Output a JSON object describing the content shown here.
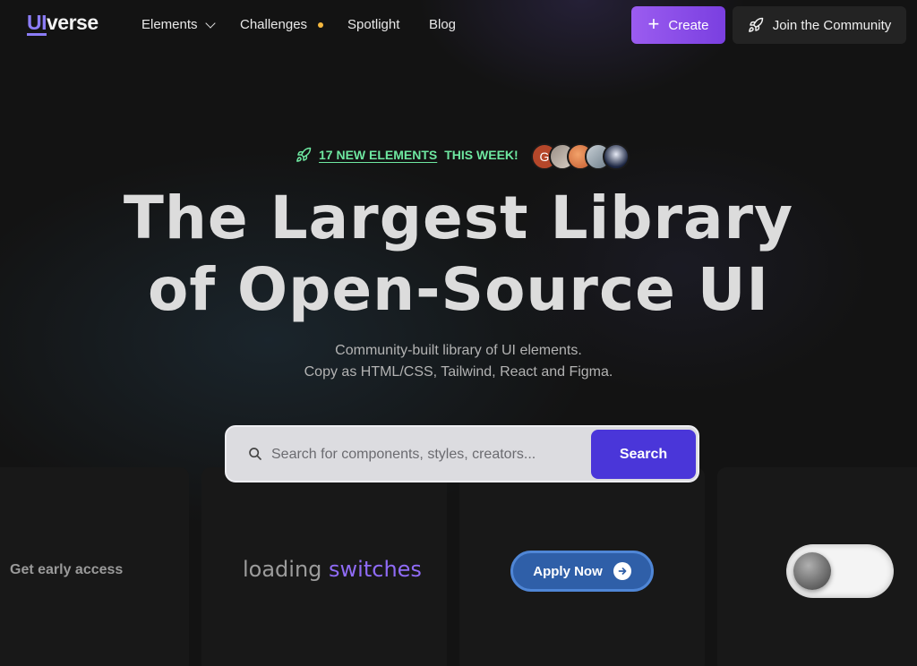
{
  "nav": {
    "logo_ui": "UI",
    "logo_rest": "verse",
    "links": [
      {
        "label": "Elements"
      },
      {
        "label": "Challenges"
      },
      {
        "label": "Spotlight"
      },
      {
        "label": "Blog"
      }
    ],
    "create_label": "Create",
    "join_label": "Join the Community"
  },
  "badge": {
    "count_text": "17 NEW ELEMENTS",
    "suffix": "THIS WEEK!",
    "avatar_initial": "G"
  },
  "hero": {
    "title_line1": "The Largest Library",
    "title_line2": "of Open-Source UI",
    "subtitle_line1": "Community-built library of UI elements.",
    "subtitle_line2": "Copy as HTML/CSS, Tailwind, React and Figma."
  },
  "search": {
    "placeholder": "Search for components, styles, creators...",
    "button_label": "Search"
  },
  "cards": {
    "early_access": "Get early access",
    "loading_word": "loading",
    "switches_word": "switches",
    "apply_label": "Apply Now"
  },
  "colors": {
    "accent_purple": "#8b7cf6",
    "create_gradient": [
      "#9b5cf0",
      "#7a3fe0"
    ],
    "search_button": "#4a36d9",
    "badge_green": "#6ee7a0",
    "dot_yellow": "#f6b83e"
  },
  "icons": {
    "chevron": "chevron-down-icon",
    "plus": "plus-icon",
    "rocket": "rocket-icon",
    "search": "search-icon",
    "arrow": "arrow-right-icon"
  }
}
